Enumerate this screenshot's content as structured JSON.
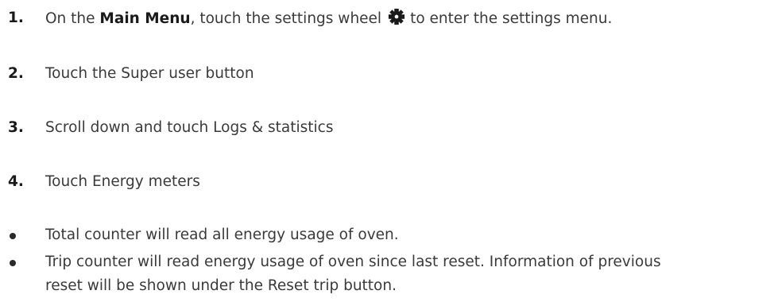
{
  "steps": [
    {
      "number": "1.",
      "prefix": "On the ",
      "bold": "Main Menu",
      "middle": ", touch the settings wheel",
      "icon": "gear-icon",
      "suffix": "to enter the settings menu."
    },
    {
      "number": "2.",
      "text": "Touch the Super user button"
    },
    {
      "number": "3.",
      "text": "Scroll down and touch Logs & statistics"
    },
    {
      "number": "4.",
      "text": "Touch Energy meters"
    }
  ],
  "bullets": [
    {
      "line1": "Total counter will read all energy usage of oven."
    },
    {
      "line1": "Trip counter will read energy usage of oven since last reset. Information of previous",
      "line2": "reset will be shown under the Reset trip button."
    }
  ],
  "colors": {
    "text": "#3a3a3a",
    "number": "#1a1a1a"
  }
}
